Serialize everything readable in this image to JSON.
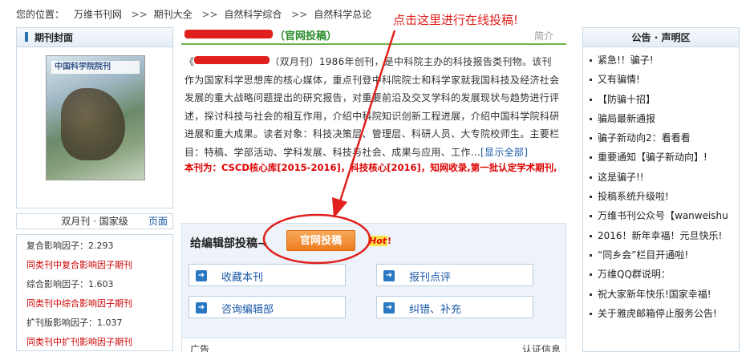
{
  "breadcrumb": {
    "label": "您的位置：",
    "items": [
      "万维书刊网",
      "期刊大全",
      "自然科学综合",
      "自然科学总论"
    ],
    "sep": ">>"
  },
  "left": {
    "cover_title": "期刊封面",
    "cover_caption": "双月刊 · 国家级",
    "cover_journal": "中国科学院院刊",
    "pager": "页面",
    "stats": [
      {
        "text": "复合影响因子：2.293",
        "style": "plain"
      },
      {
        "text": "同类刊中复合影响因子期刊",
        "style": "red"
      },
      {
        "text": "综合影响因子：1.603",
        "style": "plain"
      },
      {
        "text": "同类刊中综合影响因子期刊",
        "style": "red"
      },
      {
        "text": "扩刊版影响因子：1.037",
        "style": "plain"
      },
      {
        "text": "同类刊中扩刊影响因子期刊",
        "style": "red"
      }
    ]
  },
  "center": {
    "title_suffix": "（官网投稿）",
    "intro_tab": "简介",
    "desc_part1": "（双月刊）1986年创刊，是中科院主办的科技报告类刊物。该刊作为国家科学思想库的核心媒体，重点刊登中科院院士和科学家就我国科技及经济社会发展的重大战略问题提出的研究报告，对重要前沿及交叉学科的发展现状与趋势进行评述，探讨科技与社会的相互作用，介绍中科院知识创新工程进展，介绍中国科学院科研进展和重大成果。读者对象：科技决策层、管理层、科研人员、大专院校师生。主要栏目：特稿、学部活动、学科发展、科技与社会、成果与应用、工作...",
    "show_all": "[显示全部]",
    "core_line": "本刊为：CSCD核心库[2015-2016]，科技核心[2016]，知网收录,第一批认定学术期刊,",
    "submit_label": "给编辑部投稿→",
    "official_btn": "官网投稿",
    "hot": "Hot",
    "hot_suffix": "!",
    "actions": [
      "收藏本刊",
      "报刊点评",
      "咨询编辑部",
      "纠错、补充"
    ],
    "ad_label": "广告",
    "cert_label": "认证信息"
  },
  "annotation": {
    "text": "点击这里进行在线投稿!",
    "color": "#e0201e"
  },
  "right": {
    "title": "公告 · 声明区",
    "items": [
      "紧急!！骗子!",
      "又有骗情!",
      "【防骗十招】",
      "骗局最新通报",
      "骗子新动向2：看看看",
      "重要通知【骗子新动向】!",
      "这是骗子!!",
      "投稿系统升级啦!",
      "万维书刊公众号【wanweishu",
      "2016！新年幸福！元旦快乐!",
      "“同乡会”栏目开通啦!",
      "万维QQ群说明：",
      "祝大家新年快乐!国家幸福!",
      "关于雅虎邮箱停止服务公告!"
    ]
  },
  "colors": {
    "accent_green": "#2a8b2a",
    "link_blue": "#1c5aa8",
    "alert_red": "#cc0000",
    "button_orange": "#ee7d1f"
  }
}
